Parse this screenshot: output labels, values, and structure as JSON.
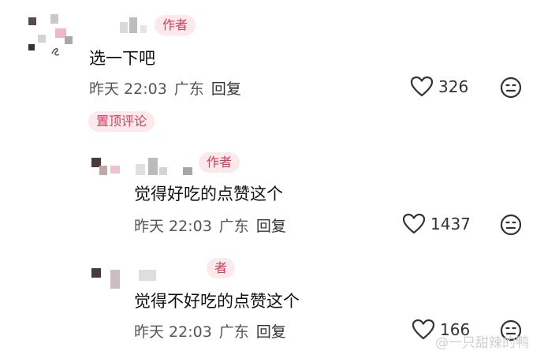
{
  "comments": [
    {
      "author_badge": "作者",
      "text": "选一下吧",
      "time": "昨天 22:03",
      "location": "广东",
      "reply_label": "回复",
      "likes": "326",
      "pinned_badge": "置顶评论"
    },
    {
      "author_badge": "作者",
      "text": "觉得好吃的点赞这个",
      "time": "昨天 22:03",
      "location": "广东",
      "reply_label": "回复",
      "likes": "1437"
    },
    {
      "author_badge": "者",
      "text": "觉得不好吃的点赞这个",
      "time": "昨天 22:03",
      "location": "广东",
      "reply_label": "回复",
      "likes": "166"
    }
  ],
  "watermark": "@一只甜辣的鸭",
  "colors": {
    "badge_bg": "#fbe9ec",
    "badge_text": "#d83d5b",
    "meta_text": "#555555"
  },
  "icons": [
    "heart-icon",
    "meh-face-icon"
  ]
}
